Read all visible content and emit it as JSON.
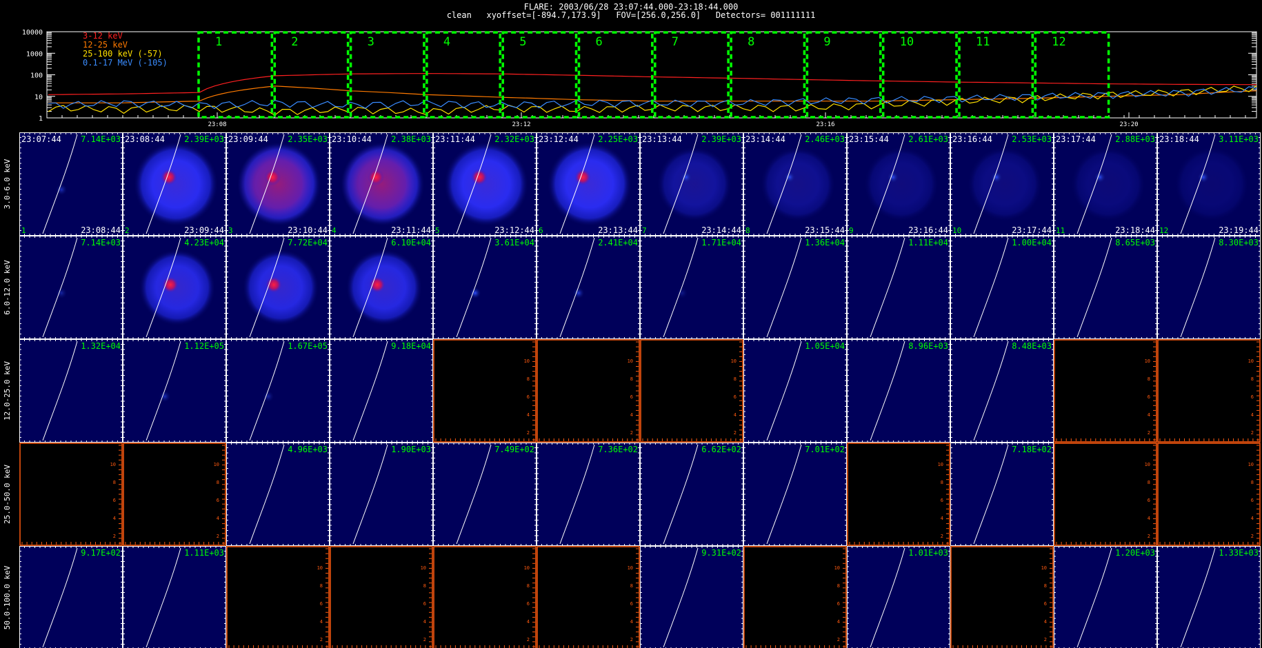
{
  "header": {
    "line1": "FLARE: 2003/06/28 23:07:44.000-23:18:44.000",
    "line2": "clean   xyoffset=[-894.7,173.9]   FOV=[256.0,256.0]   Detectors= 001111111"
  },
  "chart_data": [
    {
      "type": "line",
      "yscale": "log",
      "ylim": [
        1,
        10000
      ],
      "y_ticks": [
        "10000",
        "1000",
        "100",
        "10",
        "1"
      ],
      "x_ticks": [
        "23:08",
        "23:12",
        "23:16",
        "23:20"
      ],
      "legend": [
        {
          "label": "3-12 keV",
          "color": "#ff2020"
        },
        {
          "label": "12-25 keV",
          "color": "#ff7a00"
        },
        {
          "label": "25-100 keV (-57)",
          "color": "#ffe000"
        },
        {
          "label": "0.1-17 MeV (-105)",
          "color": "#3a8cff"
        }
      ],
      "intervals": [
        "1",
        "2",
        "3",
        "4",
        "5",
        "6",
        "7",
        "8",
        "9",
        "10",
        "11",
        "12"
      ],
      "series": [
        {
          "color": "#ff2020",
          "x": [
            0,
            1,
            2,
            3,
            4,
            5,
            6,
            7,
            8,
            9,
            10,
            11,
            12,
            13,
            14,
            15,
            16
          ],
          "values": [
            12,
            13,
            15,
            90,
            110,
            115,
            110,
            95,
            80,
            70,
            60,
            52,
            46,
            42,
            38,
            36,
            35
          ]
        },
        {
          "color": "#ff7a00",
          "x": [
            0,
            1,
            2,
            3,
            4,
            5,
            6,
            7,
            8,
            9,
            10,
            11,
            12,
            13,
            14,
            15,
            16
          ],
          "values": [
            5,
            5,
            6,
            30,
            18,
            12,
            9,
            7,
            6,
            6,
            6,
            6,
            7,
            8,
            10,
            12,
            18
          ]
        },
        {
          "color": "#ffe000",
          "x": [
            0,
            1,
            2,
            3,
            4,
            5,
            6,
            7,
            8,
            9,
            10,
            11,
            12,
            13,
            14,
            15,
            16
          ],
          "values": [
            3,
            2.5,
            3,
            2,
            2.5,
            2,
            3,
            2.5,
            3,
            3,
            3,
            4,
            6,
            8,
            12,
            16,
            25
          ]
        },
        {
          "color": "#3a8cff",
          "x": [
            0,
            1,
            2,
            3,
            4,
            5,
            6,
            7,
            8,
            9,
            10,
            11,
            12,
            13,
            14,
            15,
            16
          ],
          "values": [
            4,
            5,
            4,
            5,
            4,
            5,
            4,
            5,
            5,
            5,
            6,
            7,
            8,
            10,
            12,
            15,
            22
          ]
        }
      ]
    },
    {
      "type": "heatmap",
      "row_labels": [
        "3.0-6.0 keV",
        "6.0-12.0 keV",
        "12.0-25.0 keV",
        "25.0-50.0 keV",
        "50.0-100.0 keV"
      ],
      "start_times": [
        "23:07:44",
        "23:08:44",
        "23:09:44",
        "23:10:44",
        "23:11:44",
        "23:12:44",
        "23:13:44",
        "23:14:44",
        "23:15:44",
        "23:16:44",
        "23:17:44",
        "23:18:44"
      ],
      "end_times": [
        "23:08:44",
        "23:09:44",
        "23:10:44",
        "23:11:44",
        "23:12:44",
        "23:13:44",
        "23:14:44",
        "23:15:44",
        "23:16:44",
        "23:17:44",
        "23:18:44",
        "23:19:44"
      ],
      "interval_labels": [
        "1",
        "2",
        "3",
        "4",
        "5",
        "6",
        "7",
        "8",
        "9",
        "10",
        "11",
        "12"
      ],
      "max_values": [
        [
          "7.14E+03",
          "2.39E+03",
          "2.35E+03",
          "2.38E+03",
          "2.32E+03",
          "2.25E+03",
          "2.39E+03",
          "2.46E+03",
          "2.61E+03",
          "2.53E+03",
          "2.88E+03",
          "3.11E+03"
        ],
        [
          "7.14E+03",
          "4.23E+04",
          "7.72E+04",
          "6.10E+04",
          "3.61E+04",
          "2.41E+04",
          "1.71E+04",
          "1.36E+04",
          "1.11E+04",
          "1.00E+04",
          "8.65E+03",
          "8.30E+03"
        ],
        [
          "1.32E+04",
          "1.12E+05",
          "1.67E+05",
          "9.18E+04",
          "",
          "",
          "",
          "1.05E+04",
          "8.96E+03",
          "8.48E+03",
          "",
          ""
        ],
        [
          "",
          "",
          "4.96E+03",
          "1.90E+03",
          "7.49E+02",
          "7.36E+02",
          "6.62E+02",
          "7.01E+02",
          "",
          "7.18E+02",
          "",
          ""
        ],
        [
          "9.17E+02",
          "1.11E+03",
          "",
          "",
          "",
          "",
          "9.31E+02",
          "",
          "1.01E+03",
          "",
          "1.20E+03",
          "1.33E+03"
        ]
      ],
      "source_intensity": [
        [
          0.2,
          1,
          1,
          1,
          0.9,
          0.85,
          0.5,
          0.4,
          0.3,
          0.3,
          0.25,
          0.2
        ],
        [
          0.15,
          0.9,
          1,
          0.85,
          0.35,
          0.25,
          0.1,
          0,
          0,
          0,
          0,
          0
        ],
        [
          0,
          0.2,
          0.15,
          0,
          0,
          0,
          0,
          0,
          0,
          0,
          0,
          0
        ],
        [
          0,
          0,
          0,
          0,
          0,
          0,
          0,
          0,
          0,
          0,
          0,
          0
        ],
        [
          0,
          0,
          0,
          0,
          0,
          0,
          0,
          0,
          0,
          0,
          0,
          0
        ]
      ],
      "empty_tick_labels": [
        "2",
        "4",
        "6",
        "8",
        "10"
      ]
    }
  ]
}
